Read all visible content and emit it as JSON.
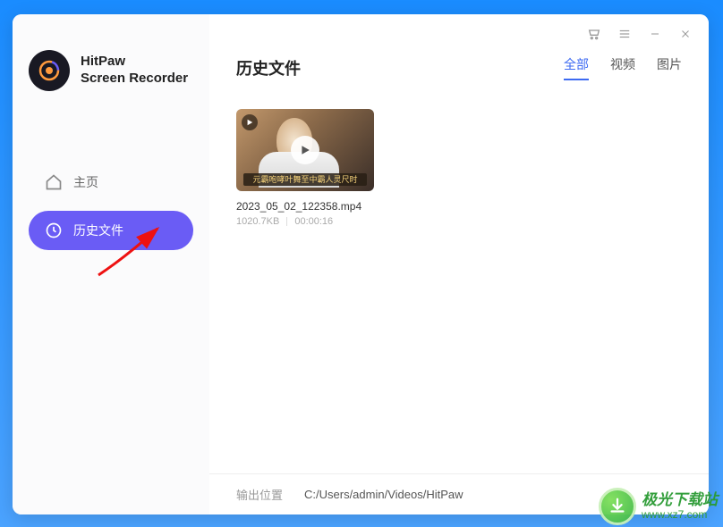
{
  "brand": {
    "line1": "HitPaw",
    "line2": "Screen Recorder"
  },
  "sidebar": {
    "home_label": "主页",
    "history_label": "历史文件"
  },
  "page": {
    "title": "历史文件"
  },
  "tabs": {
    "all": "全部",
    "video": "视频",
    "image": "图片"
  },
  "files": [
    {
      "name": "2023_05_02_122358.mp4",
      "size": "1020.7KB",
      "duration": "00:00:16",
      "caption": "元霸咆哮叶舞至中霸人灵尺时"
    }
  ],
  "footer": {
    "label": "输出位置",
    "path": "C:/Users/admin/Videos/HitPaw"
  },
  "watermark": {
    "title": "极光下载站",
    "url": "www.xz7.com"
  }
}
